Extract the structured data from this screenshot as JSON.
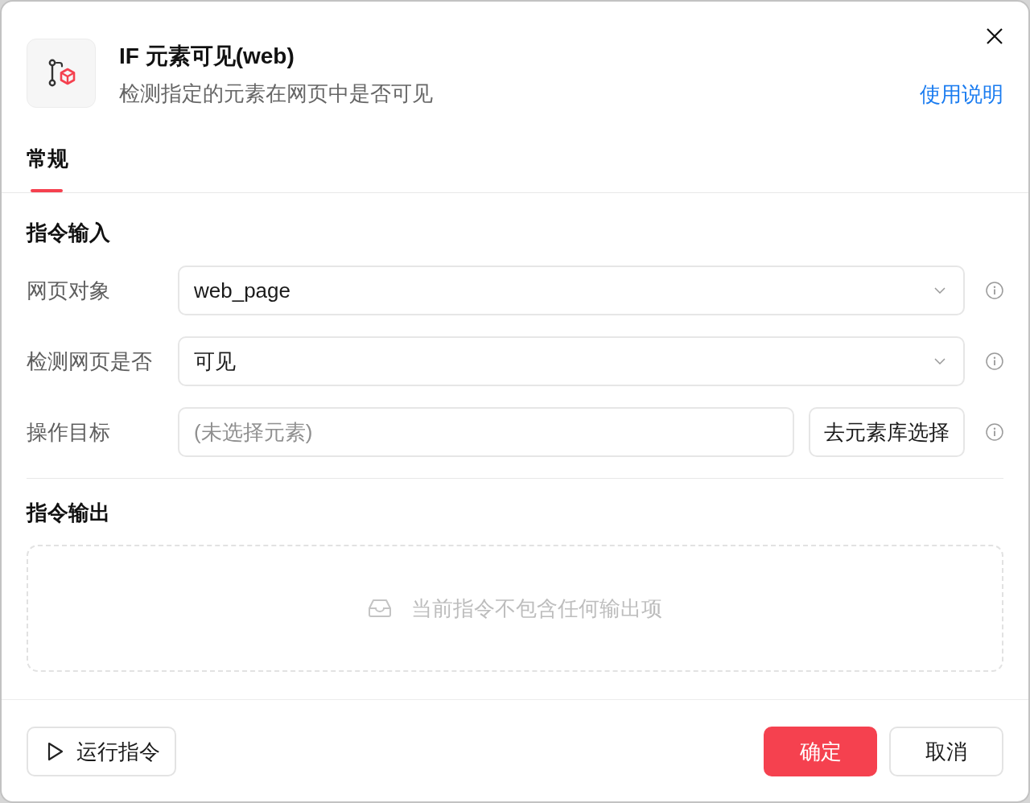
{
  "dialog": {
    "title": "IF 元素可见(web)",
    "description": "检测指定的元素在网页中是否可见",
    "help_link": "使用说明"
  },
  "tabs": [
    {
      "label": "常规",
      "selected": true
    }
  ],
  "input_section": {
    "title": "指令输入",
    "fields": [
      {
        "kind": "select",
        "label": "网页对象",
        "value": "web_page"
      },
      {
        "kind": "select",
        "label": "检测网页是否",
        "value": "可见"
      },
      {
        "kind": "picker",
        "label": "操作目标",
        "placeholder": "(未选择元素)",
        "button": "去元素库选择"
      }
    ]
  },
  "output_section": {
    "title": "指令输出",
    "empty_text": "当前指令不包含任何输出项"
  },
  "footer": {
    "run_button": "运行指令",
    "buttons": [
      {
        "label": "确定",
        "kind": "primary"
      },
      {
        "label": "取消",
        "kind": "default"
      }
    ]
  }
}
